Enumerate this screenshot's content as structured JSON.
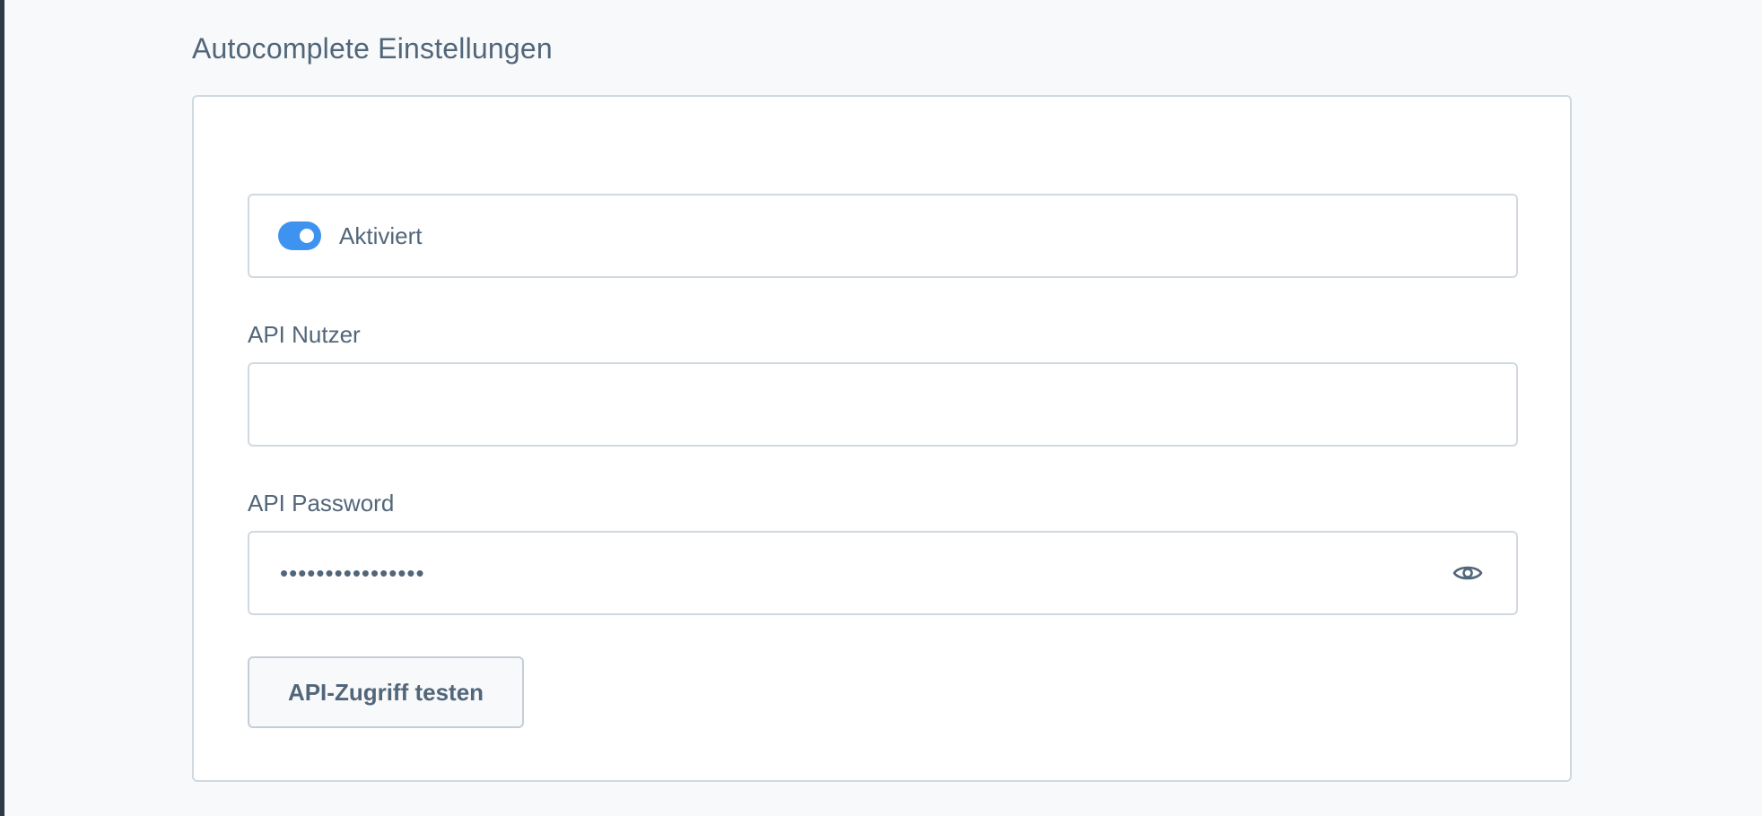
{
  "section": {
    "title": "Autocomplete Einstellungen"
  },
  "toggle": {
    "label": "Aktiviert",
    "enabled": true,
    "color": "#3f93f0"
  },
  "api_user": {
    "label": "API Nutzer",
    "value": ""
  },
  "api_password": {
    "label": "API Password",
    "value": "••••••••••••••••",
    "visibility_icon": "eye-icon"
  },
  "test_button": {
    "label": "API-Zugriff testen"
  }
}
